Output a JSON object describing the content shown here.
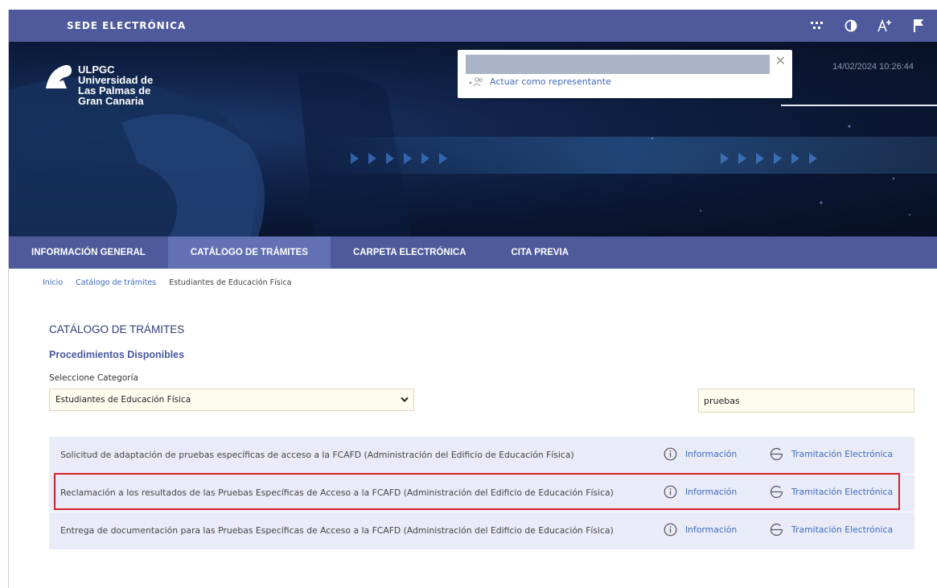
{
  "topbar": {
    "title": "SEDE ELECTRÓNICA",
    "tools": [
      "grid-icon",
      "contrast-icon",
      "text-size-icon",
      "flag-icon"
    ]
  },
  "banner": {
    "logo_lines": [
      "ULPGC",
      "Universidad de",
      "Las Palmas de",
      "Gran Canaria"
    ],
    "datetime": "14/02/2024 10:26:44"
  },
  "popup": {
    "action": "Actuar como representante"
  },
  "nav": {
    "items": [
      {
        "label": "INFORMACIÓN GENERAL",
        "active": false
      },
      {
        "label": "CATÁLOGO DE TRÁMITES",
        "active": true
      },
      {
        "label": "CARPETA ELECTRÓNICA",
        "active": false
      },
      {
        "label": "CITA PREVIA",
        "active": false
      }
    ]
  },
  "breadcrumb": {
    "items": [
      "Inicio",
      "Catálogo de trámites",
      "Estudiantes de Educación Física"
    ]
  },
  "main": {
    "heading": "CATÁLOGO DE TRÁMITES",
    "subheading": "Procedimientos Disponibles",
    "category_label": "Seleccione Categoría",
    "category_value": "Estudiantes de Educación Física",
    "search_value": "pruebas",
    "procedures": [
      {
        "title": "Solicitud de adaptación de pruebas específicas de acceso a la FCAFD (Administración del Edificio de Educación Física)",
        "info_label": "Información",
        "tram_label": "Tramitación Electrónica"
      },
      {
        "title": "Reclamación a los resultados de las Pruebas Específicas de Acceso a la FCAFD (Administración del Edificio de Educación Física)",
        "info_label": "Información",
        "tram_label": "Tramitación Electrónica"
      },
      {
        "title": "Entrega de documentación para las Pruebas Específicas de Acceso a la FCAFD (Administración del Edificio de Educación Física)",
        "info_label": "Información",
        "tram_label": "Tramitación Electrónica"
      }
    ]
  },
  "colors": {
    "primary": "#4e5a9c",
    "nav_active": "#6270b4",
    "link": "#3c6ac0",
    "highlight": "#d5212c",
    "row_bg": "#e9ecf8"
  }
}
